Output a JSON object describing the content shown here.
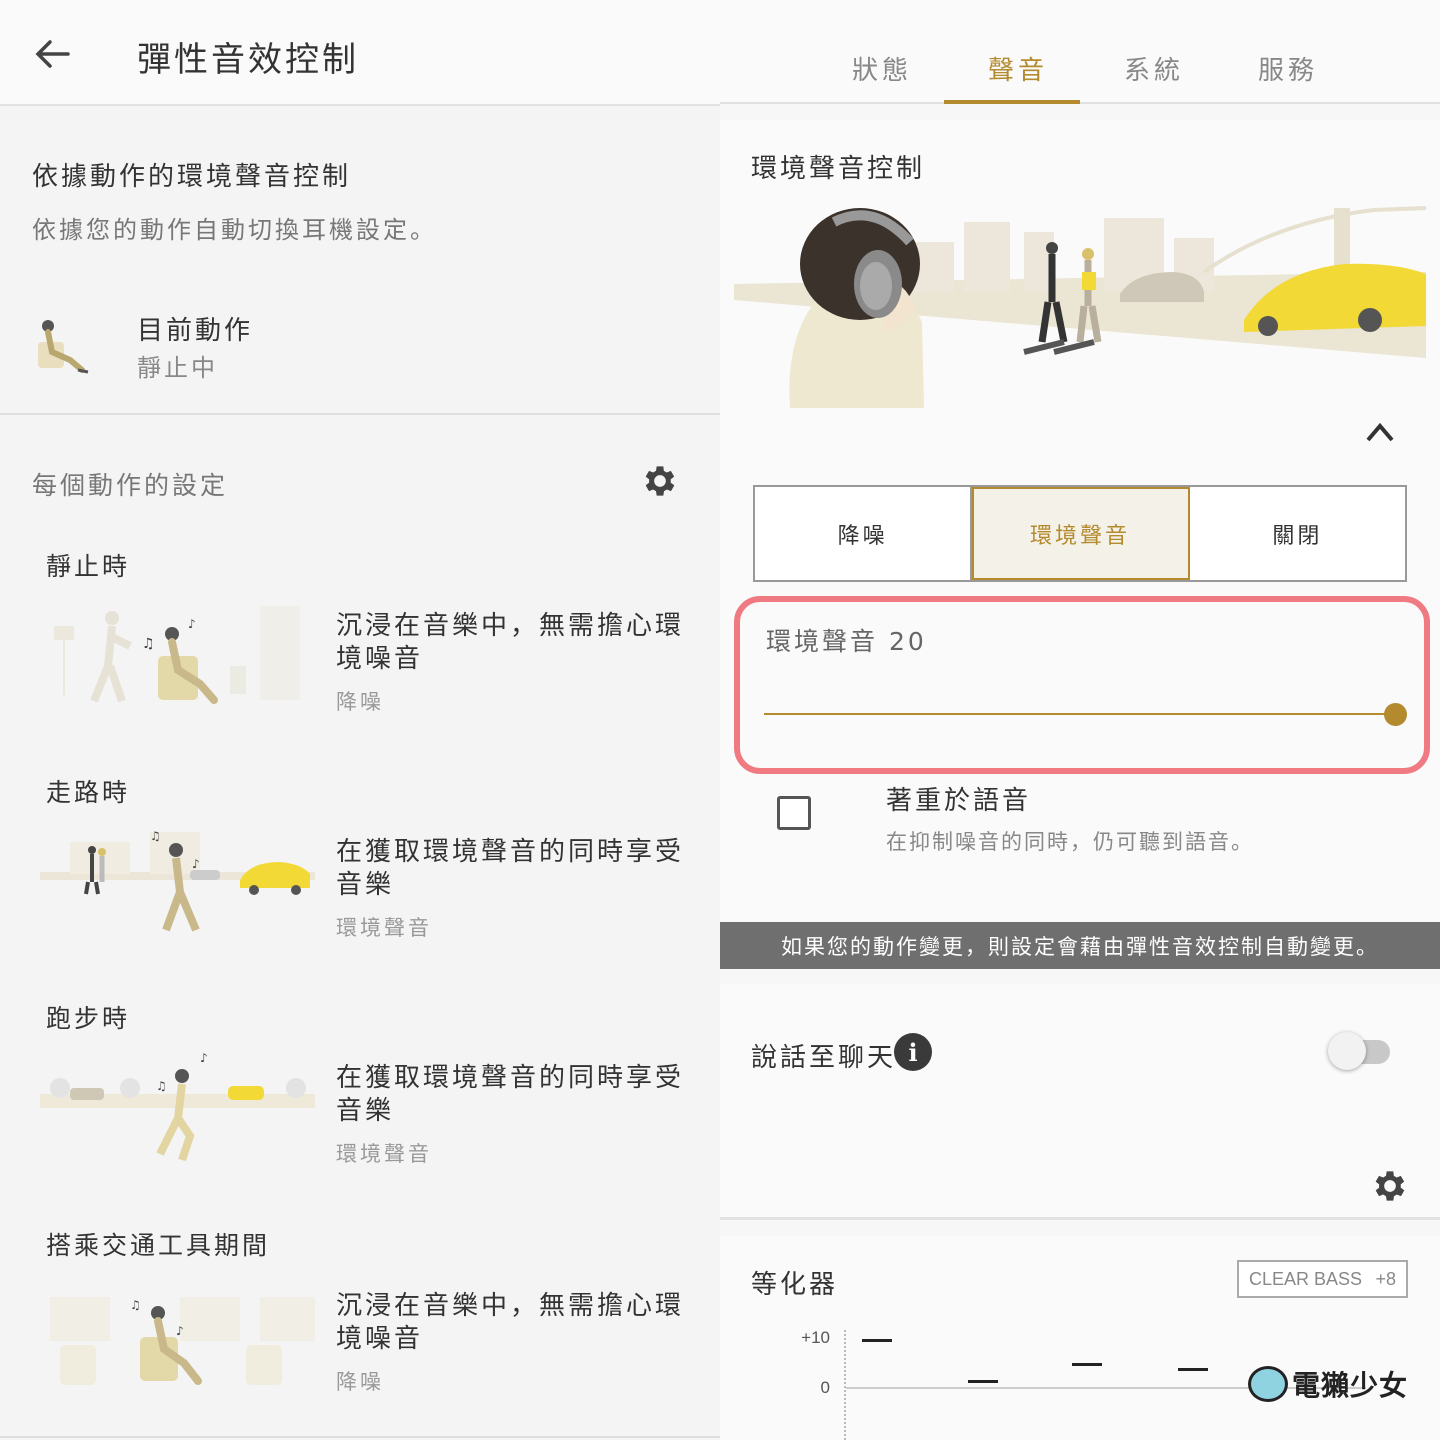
{
  "left": {
    "title": "彈性音效控制",
    "intro": {
      "title": "依據動作的環境聲音控制",
      "subtitle": "依據您的動作自動切換耳機設定。"
    },
    "current": {
      "label": "目前動作",
      "value": "靜止中"
    },
    "settings_header": "每個動作的設定",
    "activities": [
      {
        "label": "靜止時",
        "desc": "沉浸在音樂中，無需擔心環境噪音",
        "mode": "降噪"
      },
      {
        "label": "走路時",
        "desc": "在獲取環境聲音的同時享受音樂",
        "mode": "環境聲音"
      },
      {
        "label": "跑步時",
        "desc": "在獲取環境聲音的同時享受音樂",
        "mode": "環境聲音"
      },
      {
        "label": "搭乘交通工具期間",
        "desc": "沉浸在音樂中，無需擔心環境噪音",
        "mode": "降噪"
      }
    ]
  },
  "right": {
    "tabs": [
      "狀態",
      "聲音",
      "系統",
      "服務"
    ],
    "active_tab": "聲音",
    "ambient": {
      "title": "環境聲音控制",
      "modes": [
        "降噪",
        "環境聲音",
        "關閉"
      ],
      "active_mode": "環境聲音",
      "level_label": "環境聲音 20",
      "level": 20,
      "level_max": 20
    },
    "voice": {
      "title": "著重於語音",
      "subtitle": "在抑制噪音的同時，仍可聽到語音。",
      "checked": false
    },
    "banner": "如果您的動作變更，則設定會藉由彈性音效控制自動變更。",
    "speak_to_chat": {
      "label": "說話至聊天",
      "enabled": false
    },
    "equalizer": {
      "title": "等化器",
      "preset_name": "CLEAR BASS",
      "preset_value": "+8",
      "ticks": [
        "+10",
        "0"
      ]
    },
    "watermark": "電獺少女"
  },
  "colors": {
    "accent": "#b48a2e",
    "highlight": "#f07a82",
    "banner": "#6f6f6f"
  }
}
